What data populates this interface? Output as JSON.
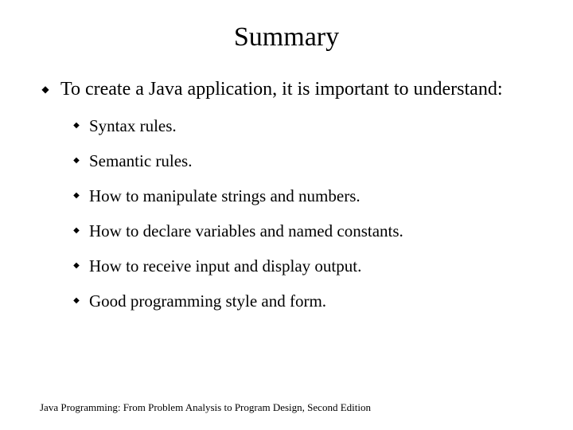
{
  "title": "Summary",
  "main": {
    "intro": "To create a Java application, it is important to understand:",
    "items": [
      "Syntax rules.",
      "Semantic rules.",
      "How to manipulate strings and numbers.",
      "How to declare variables and named constants.",
      "How to receive input and display output.",
      "Good programming style and form."
    ]
  },
  "footer": "Java Programming: From Problem Analysis to Program Design, Second Edition"
}
